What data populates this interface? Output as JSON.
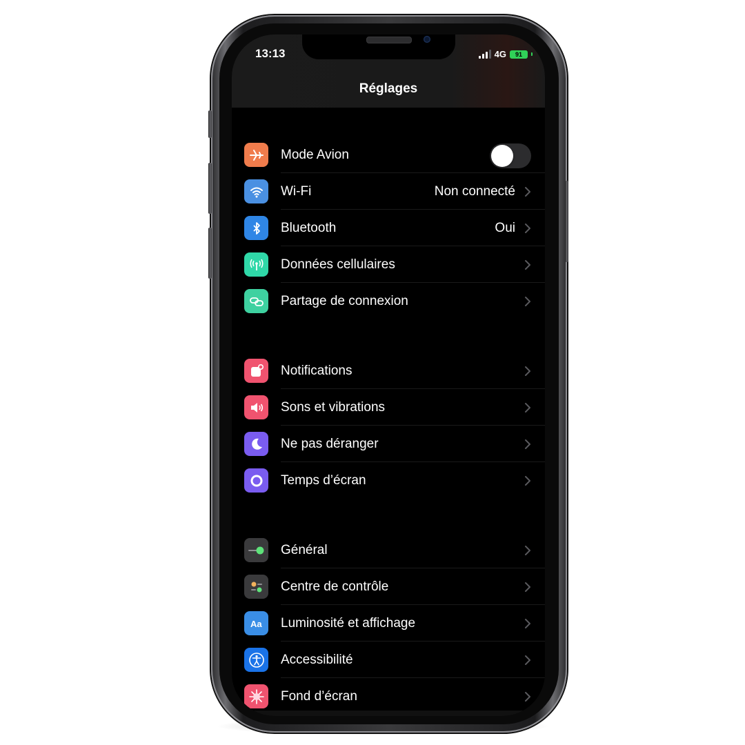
{
  "status_bar": {
    "time": "13:13",
    "network": "4G",
    "battery": "91",
    "battery_color": "#30d158",
    "signal_bars_active": 3,
    "signal_bars_total": 4
  },
  "nav": {
    "title": "Réglages"
  },
  "groups": [
    [
      {
        "label": "Mode Avion",
        "icon": "airplane-icon",
        "color": "#f07c4c",
        "toggle": true,
        "toggle_on": false
      },
      {
        "label": "Wi-Fi",
        "value": "Non connecté",
        "icon": "wifi-icon",
        "color": "#4a90e2"
      },
      {
        "label": "Bluetooth",
        "value": "Oui",
        "icon": "bluetooth-icon",
        "color": "#2f86e6"
      },
      {
        "label": "Données cellulaires",
        "icon": "antenna-icon",
        "color": "#2fd8a8"
      },
      {
        "label": "Partage de connexion",
        "icon": "chain-link-icon",
        "color": "#3ed1a0"
      }
    ],
    [
      {
        "label": "Notifications",
        "icon": "notifications-icon",
        "color": "#f0536f"
      },
      {
        "label": "Sons et vibrations",
        "icon": "speaker-icon",
        "color": "#f0536f"
      },
      {
        "label": "Ne pas déranger",
        "icon": "moon-icon",
        "color": "#7a5cf0"
      },
      {
        "label": "Temps d’écran",
        "icon": "hourglass-ring-icon",
        "color": "#7a5cf0"
      }
    ],
    [
      {
        "label": "Général",
        "icon": "gear-toggle-icon",
        "color": "#3a3a3c"
      },
      {
        "label": "Centre de contrôle",
        "icon": "control-center-icon",
        "color": "#3a3a3c"
      },
      {
        "label": "Luminosité et affichage",
        "icon": "text-aa-icon",
        "color": "#3a8ee6"
      },
      {
        "label": "Accessibilité",
        "icon": "accessibility-icon",
        "color": "#1a73e8"
      },
      {
        "label": "Fond d’écran",
        "icon": "wallpaper-flower-icon",
        "color": "#f0536f"
      }
    ]
  ]
}
